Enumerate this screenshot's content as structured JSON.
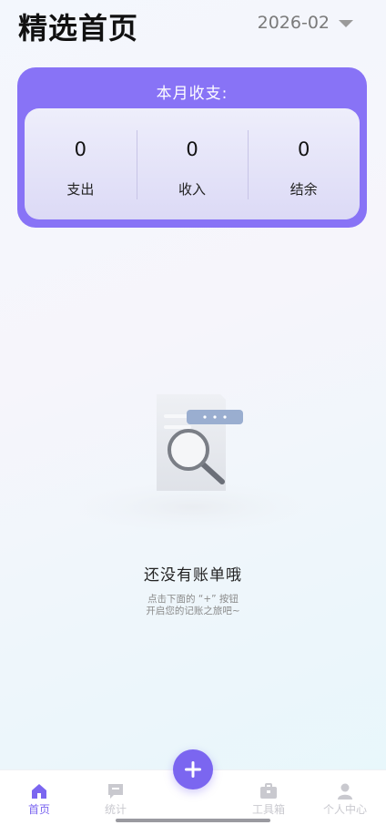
{
  "header": {
    "title": "精选首页",
    "month": "2026-02"
  },
  "summary": {
    "title": "本月收支:",
    "stats": [
      {
        "value": "0",
        "label": "支出"
      },
      {
        "value": "0",
        "label": "收入"
      },
      {
        "value": "0",
        "label": "结余"
      }
    ]
  },
  "empty": {
    "title": "还没有账单哦",
    "hint_line1": "点击下面的 “+” 按钮",
    "hint_line2": "开启您的记账之旅吧~"
  },
  "tabbar": {
    "items": [
      {
        "label": "首页",
        "icon": "home-icon",
        "active": true
      },
      {
        "label": "统计",
        "icon": "chart-icon",
        "active": false
      },
      {
        "label": "工具箱",
        "icon": "toolbox-icon",
        "active": false
      },
      {
        "label": "个人中心",
        "icon": "person-icon",
        "active": false
      }
    ],
    "add_icon": "plus-icon"
  },
  "colors": {
    "accent": "#7b66f0",
    "card": "#8873f6",
    "inactive": "#c9c9cf"
  }
}
